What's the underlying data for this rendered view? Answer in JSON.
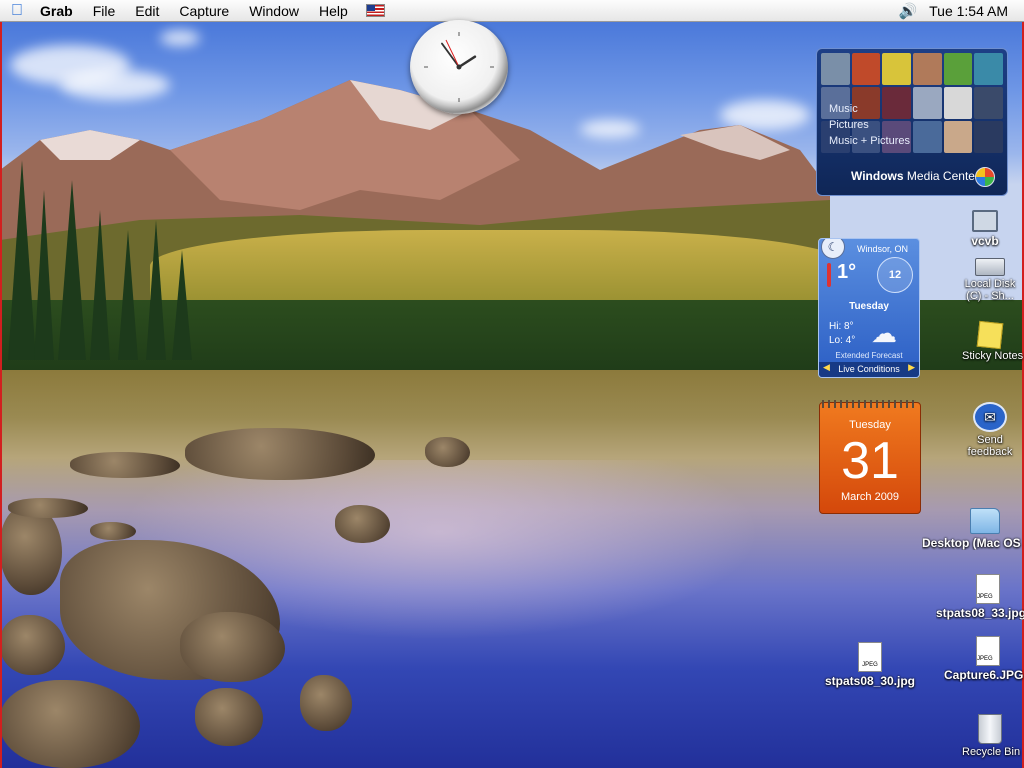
{
  "menubar": {
    "apple_icon": "apple-icon",
    "app_name": "Grab",
    "menus": [
      "File",
      "Edit",
      "Capture",
      "Window",
      "Help"
    ],
    "input_flag_icon": "us-flag-icon",
    "volume_icon": "speaker-icon",
    "clock": "Tue 1:54 AM"
  },
  "gadgets": {
    "analog_clock": {
      "hour": 1,
      "minute": 54
    },
    "media_center": {
      "menu": [
        "Music",
        "Pictures",
        "Music + Pictures"
      ],
      "brand": "Windows",
      "brand_suffix": "Media Center"
    },
    "weather": {
      "city": "Windsor, ON",
      "temperature": "1°",
      "wind": "12",
      "day": "Tuesday",
      "hi": "Hi: 8°",
      "lo": "Lo: 4°",
      "forecast_label": "Extended Forecast",
      "conditions_label": "Live Conditions"
    },
    "calendar": {
      "weekday": "Tuesday",
      "day": "31",
      "month_year": "March 2009"
    }
  },
  "desktop_icons": {
    "vcvb": "vcvb",
    "local_disk": "Local Disk (C) - Sh...",
    "sticky_notes": "Sticky Notes",
    "send_feedback": "Send feedback",
    "desktop_folder": "Desktop (Mac OS",
    "file_1": "stpats08_33.jpg",
    "file_2": "stpats08_30.jpg",
    "file_3": "Capture6.JPG",
    "recycle_bin": "Recycle Bin"
  },
  "colors": {
    "accent_red_border": "#d21f1f",
    "calendar_orange": "#e8611a",
    "weather_blue": "#3b6fd0"
  }
}
